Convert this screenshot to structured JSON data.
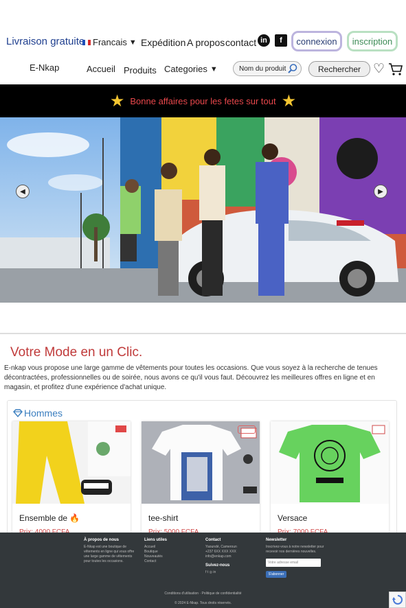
{
  "topbar": {
    "free_delivery": "Livraison gratuite",
    "language": "Francais",
    "links": [
      "Expédition",
      "A propos",
      "contact"
    ],
    "linkedin_icon": "linkedin-icon",
    "facebook_icon": "facebook-icon",
    "login_label": "connexion",
    "signup_label": "inscription"
  },
  "navbar": {
    "brand": "E-Nkap",
    "home": "Accueil",
    "products": "Produits",
    "categories": "Categories",
    "search_placeholder": "Nom du produit",
    "search_button": "Rechercher"
  },
  "promo": {
    "text": "Bonne affaires pour les fetes sur tout"
  },
  "intro": {
    "headline": "Votre Mode en un Clic.",
    "description": "E-nkap vous propose une large gamme de vêtements pour toutes les occasions. Que vous soyez à la recherche de tenues décontractées, professionnelles ou de soirée, nous avons ce qu'il vous faut. Découvrez les meilleures offres en ligne et en magasin, et profitez d'une expérience d'achat unique."
  },
  "section": {
    "title": "Hommes",
    "products": [
      {
        "name": "Ensemble de 🔥",
        "price": "Prix: 4000 FCFA"
      },
      {
        "name": "tee-shirt",
        "price": "Prix: 5000 FCFA"
      },
      {
        "name": "Versace",
        "price": "Prix: 7000 FCFA"
      }
    ]
  },
  "footer": {
    "about_title": "À propos de nous",
    "about_text": "E-Nkap est une boutique de vêtements en ligne qui vous offre une large gamme de vêtements pour toutes les occasions.",
    "links_title": "Liens utiles",
    "links": [
      "Accueil",
      "Boutique",
      "Nouveautés",
      "Contact"
    ],
    "contact_title": "Contact",
    "contact_lines": [
      "Yaoundé, Cameroun",
      "+237 6XX XXX XXX",
      "info@enkap.com"
    ],
    "follow_title": "Suivez-nous",
    "newsletter_title": "Newsletter",
    "newsletter_text": "Inscrivez-vous à notre newsletter pour recevoir nos dernières nouvelles.",
    "newsletter_placeholder": "Votre adresse email",
    "newsletter_button": "S'abonner",
    "terms": "Conditions d'utilisation · Politique de confidentialité",
    "copyright": "© 2024 E-Nkap. Tous droits réservés."
  }
}
